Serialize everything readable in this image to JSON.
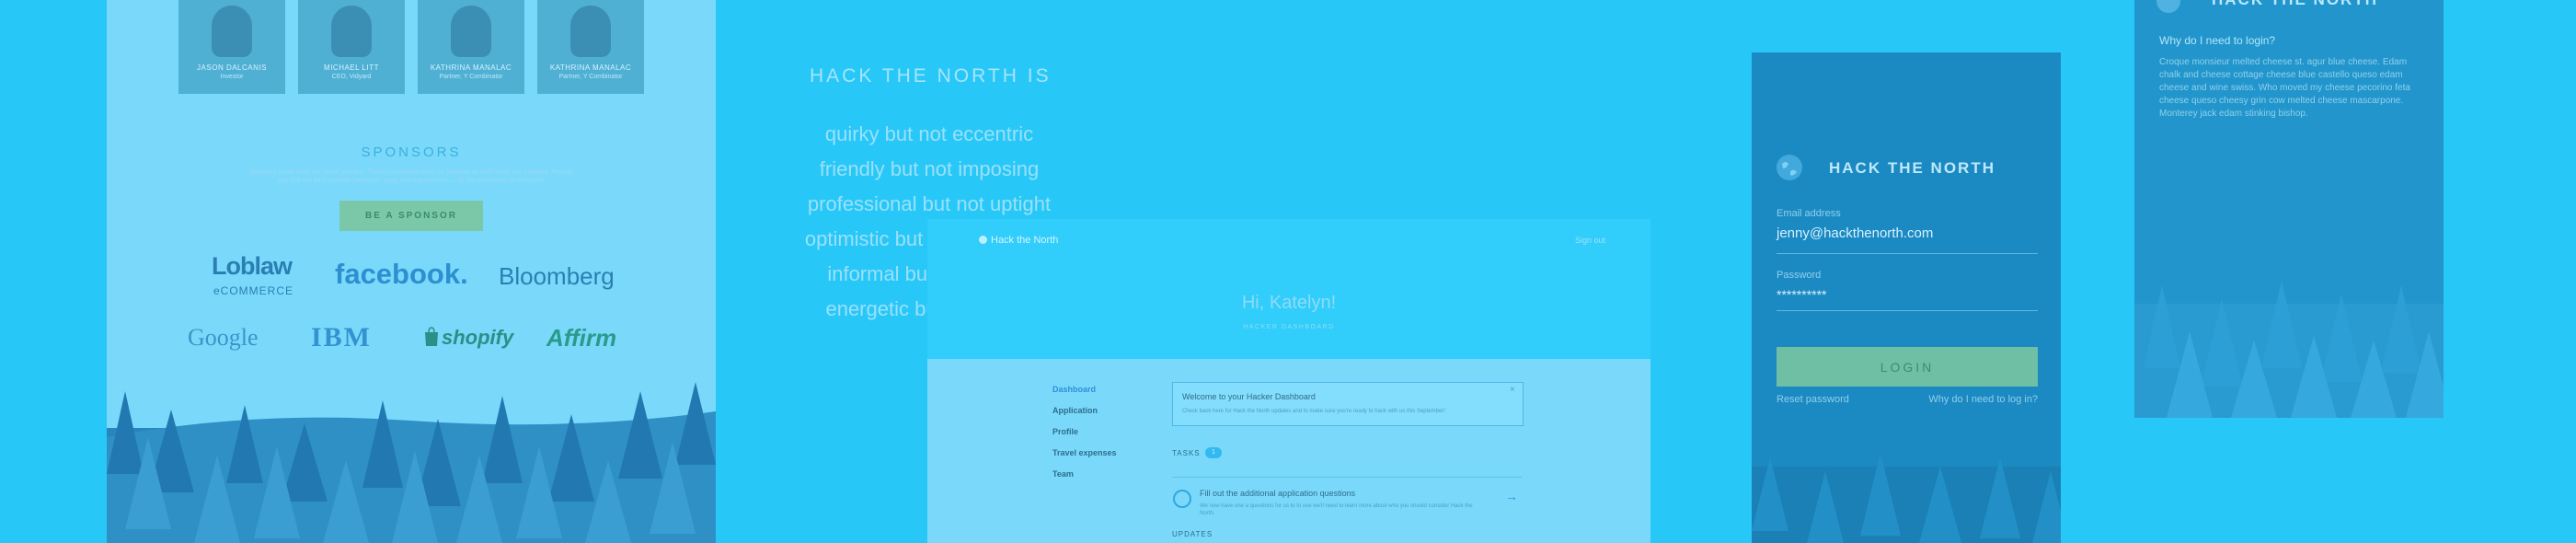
{
  "team": [
    {
      "name": "JASON DALCANIS",
      "role": "Investor"
    },
    {
      "name": "MICHAEL LITT",
      "role": "CEO, Vidyard"
    },
    {
      "name": "KATHRINA MANALAC",
      "role": "Partner, Y Combinator"
    },
    {
      "name": "KATHRINA MANALAC",
      "role": "Partner, Y Combinator"
    }
  ],
  "sponsors": {
    "title": "SPONSORS",
    "description": "Sponsors make Hack the North possible. These companies make us possible as well! Keep you involved. Provide you with the best possible hardware, swag and experiences — all complimentary to everyone.",
    "button": "BE A SPONSOR",
    "logos": [
      "Loblaw",
      "eCOMMERCE",
      "facebook.",
      "Bloomberg",
      "Google",
      "IBM",
      "shopify",
      "Affirm"
    ]
  },
  "hack_the_north_is": {
    "heading": "HACK THE NORTH IS",
    "lines": [
      "quirky but not eccentric",
      "friendly but not imposing",
      "professional but not uptight",
      "optimistic but not unrealistic",
      "informal but not sloppy",
      "energetic but not hyper"
    ]
  },
  "dashboard": {
    "brand": "Hack the North",
    "sign_out": "Sign out",
    "greeting": "Hi, Katelyn!",
    "subtitle": "HACKER DASHBOARD",
    "nav": [
      "Dashboard",
      "Application",
      "Profile",
      "Travel expenses",
      "Team"
    ],
    "welcome_title": "Welcome to your Hacker Dashboard",
    "welcome_body": "Check back here for Hack the North updates and to make sure you're ready to hack with us this September!",
    "tasks_label": "TASKS",
    "tasks_count": "1",
    "task_title": "Fill out the additional application questions",
    "task_body": "We now have one a questions for us to to use we'll need to learn more about who you should consider Hack the North.",
    "updates_label": "UPDATES"
  },
  "login": {
    "brand": "HACK THE NORTH",
    "email_label": "Email address",
    "email_value": "jenny@hackthenorth.com",
    "password_label": "Password",
    "password_value": "**********",
    "button": "LOGIN",
    "reset": "Reset password",
    "why": "Why do I need to log in?"
  },
  "faq": {
    "brand": "HACK THE NORTH",
    "title": "Why do I need to login?",
    "body": "Croque monsieur melted cheese st. agur blue cheese. Edam chalk and cheese cottage cheese blue castello queso edam cheese and wine swiss. Who moved my cheese pecorino feta cheese queso cheesy grin cow melted cheese mascarpone. Monterey jack edam stinking bishop."
  },
  "colors": {
    "background": "#27c8f8",
    "accent_green": "#7ac8a8",
    "login_panel": "#1c8ac2"
  }
}
